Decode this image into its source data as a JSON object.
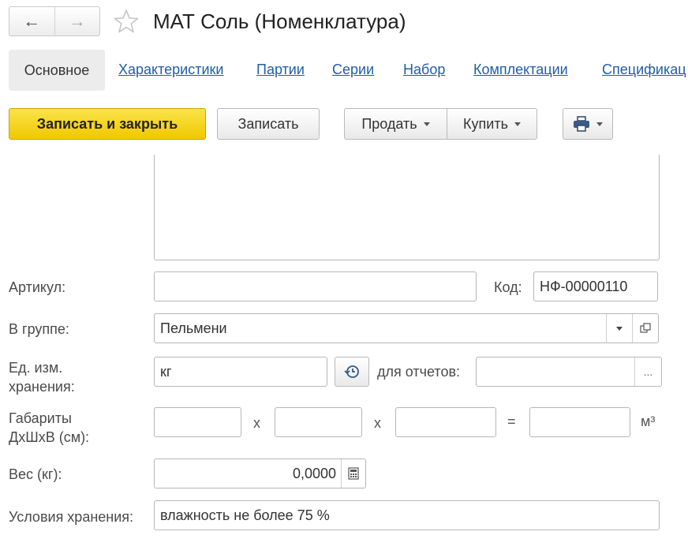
{
  "window": {
    "title": "МАТ Соль (Номенклатура)"
  },
  "nav": {
    "back_icon": "←",
    "forward_icon": "→"
  },
  "tabs": [
    {
      "label": "Основное"
    },
    {
      "label": "Характеристики"
    },
    {
      "label": "Партии"
    },
    {
      "label": "Серии"
    },
    {
      "label": "Набор"
    },
    {
      "label": "Комплектации"
    },
    {
      "label": "Спецификац"
    }
  ],
  "toolbar": {
    "save_close_label": "Записать и закрыть",
    "save_label": "Записать",
    "sell_label": "Продать",
    "buy_label": "Купить",
    "print_icon": "printer-icon"
  },
  "form": {
    "article_label": "Артикул:",
    "article_value": "",
    "code_label": "Код:",
    "code_value": "НФ-00000110",
    "group_label": "В группе:",
    "group_value": "Пельмени",
    "unit_label_line1": "Ед. изм.",
    "unit_label_line2": "хранения:",
    "unit_value": "кг",
    "reports_label": "для отчетов:",
    "reports_value": "",
    "reports_button": "...",
    "dims_label_line1": "Габариты",
    "dims_label_line2": "ДхШхВ (см):",
    "dims_x1": "x",
    "dims_x2": "x",
    "dims_eq": "=",
    "dims_unit": "м³",
    "weight_label": "Вес (кг):",
    "weight_value": "0,0000",
    "storage_label": "Условия хранения:",
    "storage_value": "влажность не более 75 %"
  },
  "colors": {
    "primary_button": "#f5d313",
    "link": "#1f5ea8"
  }
}
